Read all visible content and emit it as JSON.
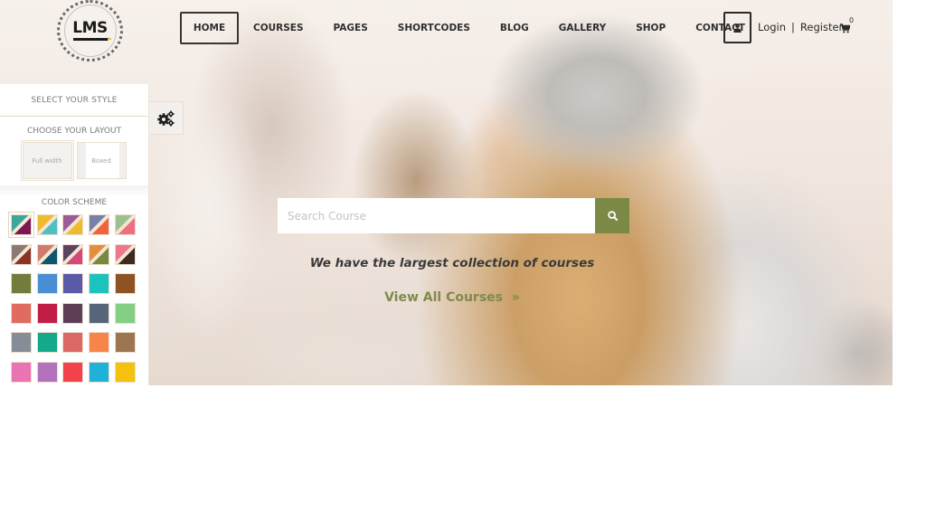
{
  "brand": {
    "logo_text": "LMS"
  },
  "nav": {
    "items": [
      {
        "label": "HOME",
        "active": true
      },
      {
        "label": "COURSES"
      },
      {
        "label": "PAGES"
      },
      {
        "label": "SHORTCODES"
      },
      {
        "label": "BLOG"
      },
      {
        "label": "GALLERY"
      },
      {
        "label": "SHOP"
      },
      {
        "label": "CONTACT"
      }
    ],
    "user_icon": "user-icon",
    "login_label": "Login",
    "separator": "|",
    "register_label": "Register",
    "cart_icon": "shopping-cart-icon",
    "cart_count": "0"
  },
  "style_panel": {
    "title": "SELECT YOUR STYLE",
    "layout_heading": "CHOOSE YOUR LAYOUT",
    "layouts": [
      {
        "label": "Full width",
        "active": true
      },
      {
        "label": "Boxed"
      }
    ],
    "color_scheme_heading": "COLOR SCHEME",
    "toggle_icon": "gears-icon",
    "swatches": [
      {
        "top": "#3fa79a",
        "bottom": "#7c1550",
        "active": true
      },
      {
        "top": "#efbb2e",
        "bottom": "#4fbfc4"
      },
      {
        "top": "#9b5b97",
        "bottom": "#efbb2e"
      },
      {
        "top": "#7a7fa8",
        "bottom": "#f4613f"
      },
      {
        "top": "#9ec08f",
        "bottom": "#ee6e82"
      },
      {
        "top": "#8a7b70",
        "bottom": "#8b3324"
      },
      {
        "top": "#d17b70",
        "bottom": "#0e566e"
      },
      {
        "top": "#5c4360",
        "bottom": "#d4497a"
      },
      {
        "top": "#e38d3d",
        "bottom": "#77893f"
      },
      {
        "top": "#f0768d",
        "bottom": "#3e2a1e"
      },
      {
        "color": "#737c3c"
      },
      {
        "color": "#4a8fd5"
      },
      {
        "color": "#5a5aa8"
      },
      {
        "color": "#1cc3bc"
      },
      {
        "color": "#8f5323"
      },
      {
        "color": "#e06b60"
      },
      {
        "color": "#c21d45"
      },
      {
        "color": "#5e3e55"
      },
      {
        "color": "#56657a"
      },
      {
        "color": "#84cf84"
      },
      {
        "color": "#858d97"
      },
      {
        "color": "#14a98a"
      },
      {
        "color": "#dd6868"
      },
      {
        "color": "#f7854a"
      },
      {
        "color": "#9c7650"
      },
      {
        "color": "#ea74b3"
      },
      {
        "color": "#b272be"
      },
      {
        "color": "#f2424c"
      },
      {
        "color": "#1fb2d8"
      },
      {
        "color": "#f4c20e"
      }
    ]
  },
  "hero": {
    "search_placeholder": "Search Course",
    "search_value": "",
    "search_icon": "search-icon",
    "tagline": "We have the largest collection of courses",
    "cta_label": "View All Courses",
    "cta_icon": "»"
  },
  "colors": {
    "accent": "#7a8a46",
    "nav_text": "#2f2f2f",
    "cta_text": "#7f8a4c"
  }
}
